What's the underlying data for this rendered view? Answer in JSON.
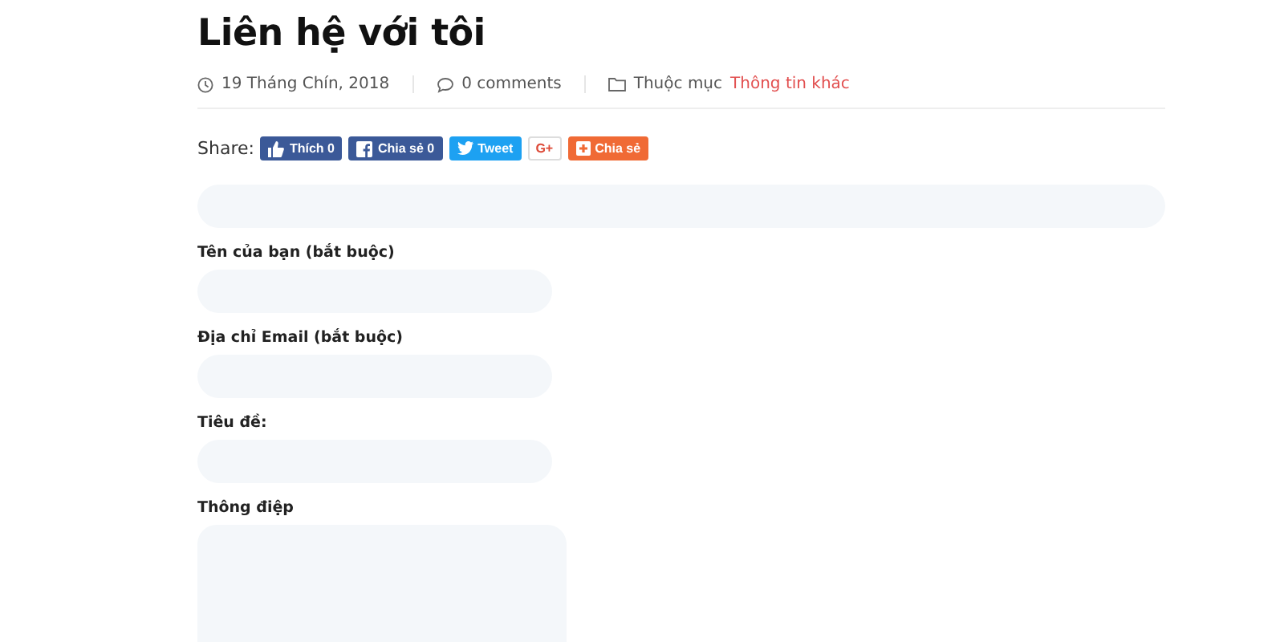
{
  "title": "Liên hệ với tôi",
  "meta": {
    "date": "19 Tháng Chín, 2018",
    "comments": "0 comments",
    "category_label": "Thuộc mục",
    "category": "Thông tin khác"
  },
  "share": {
    "label": "Share:",
    "buttons": [
      {
        "kind": "like",
        "label": "Thích 0"
      },
      {
        "kind": "facebook",
        "label": "Chia sẻ 0"
      },
      {
        "kind": "twitter",
        "label": "Tweet"
      },
      {
        "kind": "google",
        "label": "G+"
      },
      {
        "kind": "share",
        "label": "Chia sẻ"
      }
    ]
  },
  "form": {
    "fields": [
      {
        "kind": "bare"
      },
      {
        "kind": "input",
        "label": "Tên của bạn (bắt buộc)"
      },
      {
        "kind": "input",
        "label": "Địa chỉ Email (bắt buộc)"
      },
      {
        "kind": "input",
        "label": "Tiêu đề:"
      },
      {
        "kind": "textarea",
        "label": "Thông điệp"
      }
    ]
  }
}
